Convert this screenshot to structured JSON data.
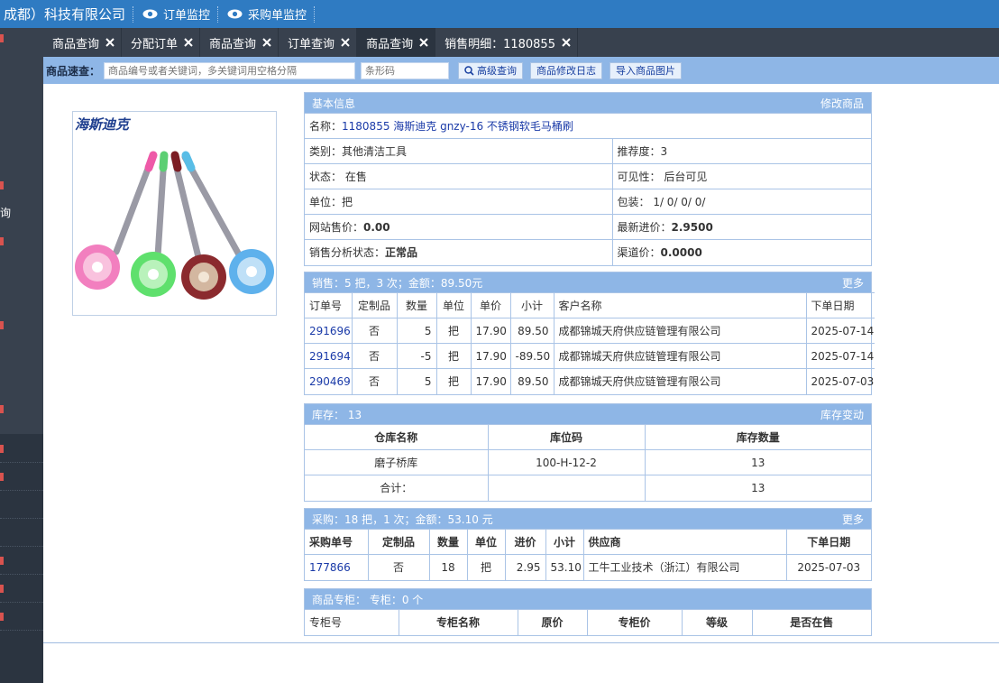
{
  "header": {
    "company": "成都）科技有限公司",
    "monitors": [
      {
        "label": "订单监控"
      },
      {
        "label": "采购单监控"
      }
    ]
  },
  "sidebar": {
    "visible_text": "询"
  },
  "tabs": [
    {
      "label": "商品查询"
    },
    {
      "label": "分配订单"
    },
    {
      "label": "商品查询"
    },
    {
      "label": "订单查询"
    },
    {
      "label": "商品查询",
      "active": true
    },
    {
      "label": "销售明细：1180855"
    }
  ],
  "search": {
    "label": "商品速查：",
    "keyword_placeholder": "商品编号或者关键词，多关键词用空格分隔",
    "barcode_placeholder": "条形码",
    "buttons": {
      "advanced": "高级查询",
      "log": "商品修改日志",
      "import_image": "导入商品图片"
    }
  },
  "product_image": {
    "brand_text": "海斯迪克"
  },
  "basic_info": {
    "title": "基本信息",
    "action": "修改商品",
    "name_label": "名称：",
    "name_value": "1180855 海斯迪克 gnzy-16 不锈钢软毛马桶刷",
    "category": "类别：其他清洁工具",
    "recommend": "推荐度：3",
    "status": "状态： 在售",
    "visibility": "可见性： 后台可见",
    "unit": "单位：把",
    "package": "包装： 1/ 0/ 0/ 0/",
    "web_price_label": "网站售价：",
    "web_price": "0.00",
    "latest_cost_label": "最新进价：",
    "latest_cost": "2.9500",
    "analysis_label": "销售分析状态：",
    "analysis_value": "正常品",
    "channel_price_label": "渠道价：",
    "channel_price": "0.0000"
  },
  "sales": {
    "title": "销售：5 把，3 次；金额：89.50元",
    "action": "更多",
    "columns": [
      "订单号",
      "定制品",
      "数量",
      "单位",
      "单价",
      "小计",
      "客户名称",
      "下单日期"
    ],
    "rows": [
      [
        "291696",
        "否",
        "5",
        "把",
        "17.90",
        "89.50",
        "成都锦城天府供应链管理有限公司",
        "2025-07-14"
      ],
      [
        "291694",
        "否",
        "-5",
        "把",
        "17.90",
        "-89.50",
        "成都锦城天府供应链管理有限公司",
        "2025-07-14"
      ],
      [
        "290469",
        "否",
        "5",
        "把",
        "17.90",
        "89.50",
        "成都锦城天府供应链管理有限公司",
        "2025-07-03"
      ]
    ]
  },
  "stock": {
    "title": "库存： 13",
    "action": "库存变动",
    "columns": [
      "仓库名称",
      "库位码",
      "库存数量"
    ],
    "rows": [
      [
        "磨子桥库",
        "100-H-12-2",
        "13"
      ]
    ],
    "total_label": "合计：",
    "total_value": "13"
  },
  "purchase": {
    "title": "采购：18 把，1 次；金额：53.10 元",
    "action": "更多",
    "columns": [
      "采购单号",
      "定制品",
      "数量",
      "单位",
      "进价",
      "小计",
      "供应商",
      "下单日期"
    ],
    "rows": [
      [
        "177866",
        "否",
        "18",
        "把",
        "2.95",
        "53.10",
        "工牛工业技术（浙江）有限公司",
        "2025-07-03"
      ]
    ]
  },
  "counter": {
    "title": "商品专柜： 专柜：0 个",
    "columns": [
      "专柜号",
      "专柜名称",
      "原价",
      "专柜价",
      "等级",
      "是否在售"
    ]
  },
  "colors": {
    "header_blue": "#2f7bc2",
    "sidebar_dark": "#2b3440",
    "panel_blue": "#8eb6e6",
    "link": "#1a3aa8"
  }
}
